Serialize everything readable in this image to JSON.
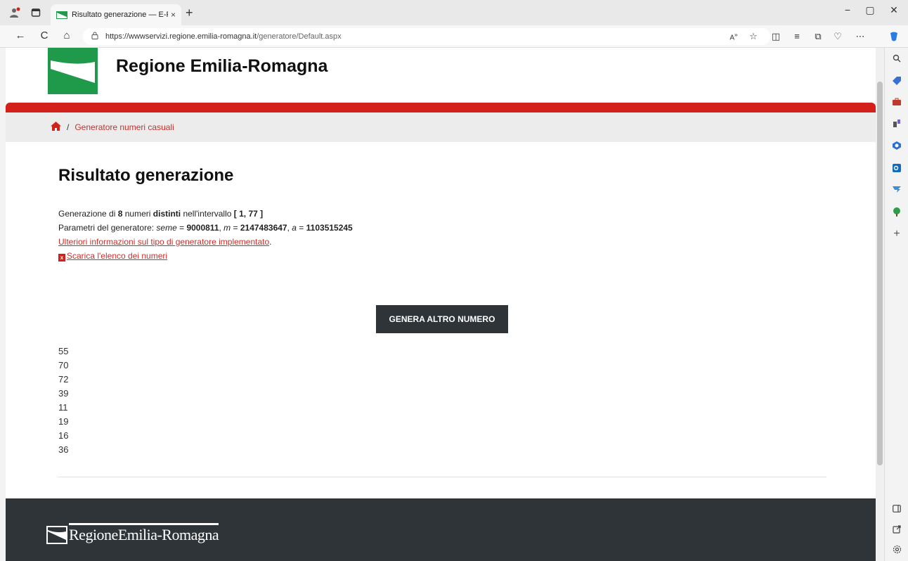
{
  "browser": {
    "tab_title": "Risultato generazione — E-R Il p",
    "tab_close": "×",
    "new_tab": "+",
    "url_host": "https://wwwservizi.regione.emilia-romagna.it",
    "url_path": "/generatore/Default.aspx",
    "win_min": "−",
    "win_max": "▢",
    "win_close": "✕",
    "nav_back": "←",
    "nav_reload": "C",
    "nav_home": "⌂"
  },
  "header": {
    "site_title": "Regione Emilia-Romagna"
  },
  "breadcrumb": {
    "separator": "/",
    "current": "Generatore numeri casuali"
  },
  "main": {
    "title": "Risultato generazione",
    "line1_a": "Generazione di ",
    "line1_count": "8",
    "line1_b": " numeri ",
    "line1_distinct": "distinti",
    "line1_c": " nell'intervallo ",
    "line1_range": "[ 1, 77 ]",
    "line2_a": "Parametri del generatore: ",
    "line2_seme_label": "seme",
    "line2_eq": " = ",
    "line2_seme": "9000811",
    "line2_sep": ", ",
    "line2_m_label": "m",
    "line2_m": "2147483647",
    "line2_a_label": "a",
    "line2_a_val": "1103515245",
    "info_link": "Ulteriori informazioni sul tipo di generatore implementato",
    "info_link_dot": ".",
    "download_link": "Scarica l'elenco dei numeri",
    "generate_button": "GENERA ALTRO NUMERO",
    "numbers": [
      "55",
      "70",
      "72",
      "39",
      "11",
      "19",
      "16",
      "36"
    ]
  },
  "footer": {
    "logo_text": "RegioneEmilia-Romagna"
  },
  "colors": {
    "brand_red": "#d3201b",
    "link_red": "#c9302c",
    "footer_dark": "#2f3438",
    "logo_green": "#1f9a4a"
  }
}
